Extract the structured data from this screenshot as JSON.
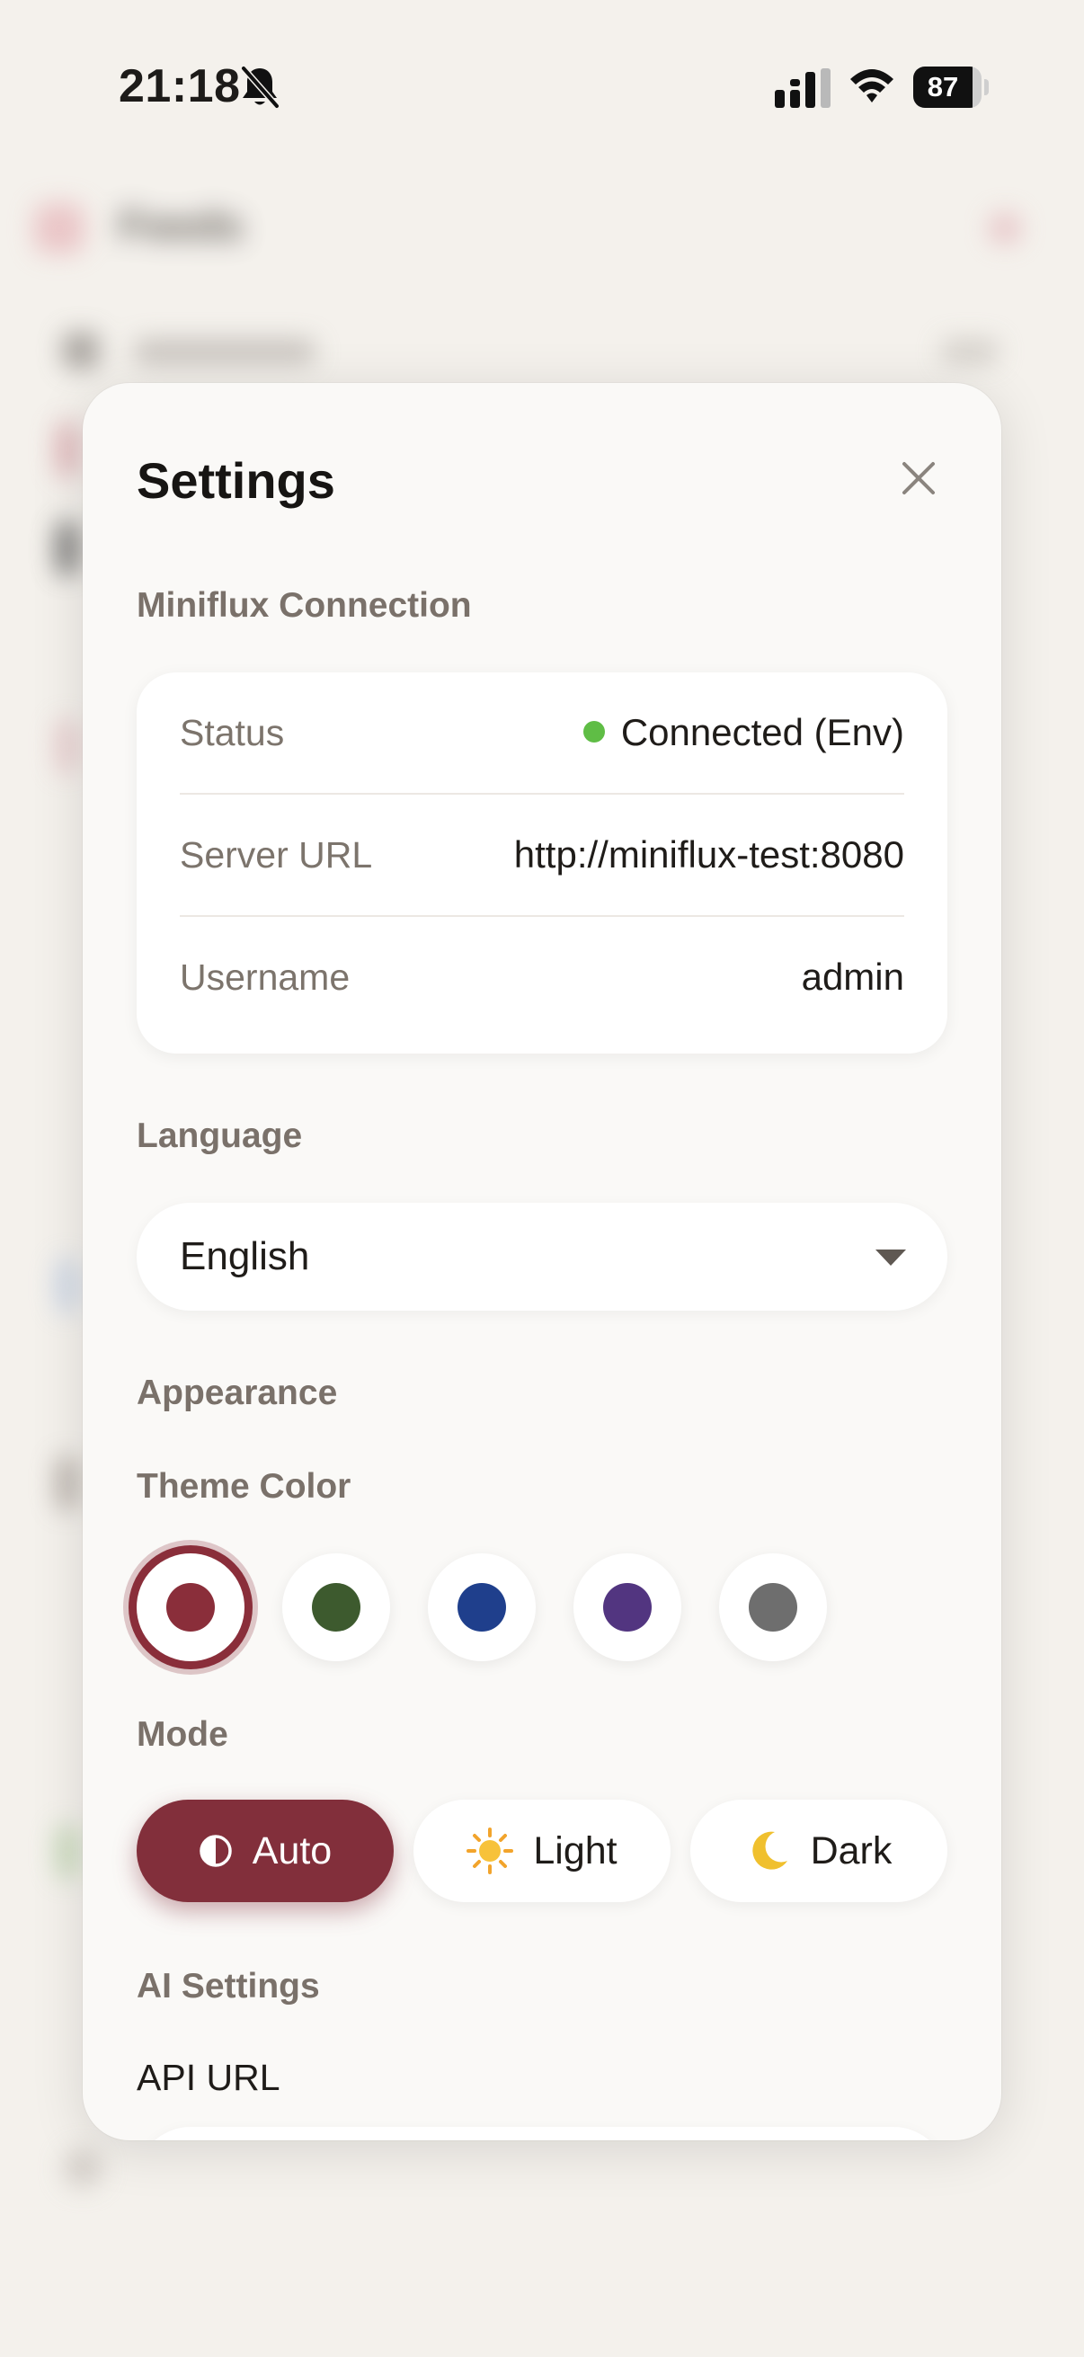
{
  "status_bar": {
    "time": "21:18",
    "battery": "87",
    "battery_level": 0.87,
    "icons": [
      "bell-slash-icon",
      "cellular-signal-icon",
      "wifi-icon",
      "battery-icon"
    ]
  },
  "background": {
    "title": "Feeds"
  },
  "settings": {
    "title": "Settings",
    "close_icon": "close-icon",
    "connection": {
      "section_label": "Miniflux Connection",
      "rows": [
        {
          "label": "Status",
          "value": "Connected (Env)",
          "status_color": "#5fbd45"
        },
        {
          "label": "Server URL",
          "value": "http://miniflux-test:8080"
        },
        {
          "label": "Username",
          "value": "admin"
        }
      ]
    },
    "language": {
      "section_label": "Language",
      "selected": "English"
    },
    "appearance": {
      "section_label": "Appearance",
      "theme_color_label": "Theme Color",
      "theme_colors": [
        {
          "name": "crimson",
          "hex": "#8a2e3a",
          "selected": true
        },
        {
          "name": "green",
          "hex": "#3d5a2e",
          "selected": false
        },
        {
          "name": "blue",
          "hex": "#1f3f8c",
          "selected": false
        },
        {
          "name": "purple",
          "hex": "#523580",
          "selected": false
        },
        {
          "name": "gray",
          "hex": "#6e6e6e",
          "selected": false
        }
      ],
      "mode_label": "Mode",
      "modes": [
        {
          "label": "Auto",
          "icon": "half-circle-icon",
          "active": true
        },
        {
          "label": "Light",
          "icon": "sun-icon",
          "active": false
        },
        {
          "label": "Dark",
          "icon": "moon-icon",
          "active": false
        }
      ]
    },
    "ai": {
      "section_label": "AI Settings",
      "api_url_label": "API URL"
    }
  },
  "colors": {
    "accent": "#822f3b",
    "page_bg": "#f4f1ec",
    "modal_bg": "#faf9f7"
  }
}
